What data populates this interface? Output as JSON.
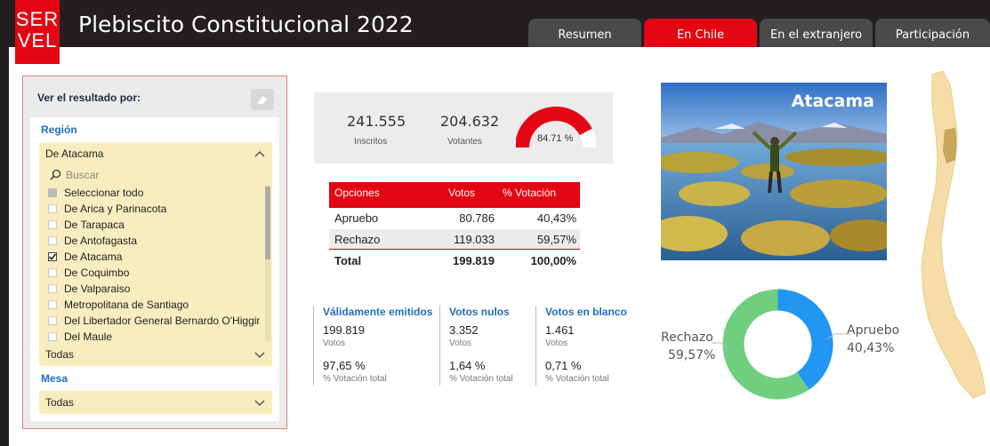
{
  "header": {
    "logo_top": "SER",
    "logo_bottom": "VEL",
    "title": "Plebiscito Constitucional 2022",
    "colors": {
      "brand": "#e30613",
      "header_bg": "#231f20"
    }
  },
  "tabs": [
    {
      "label": "Resumen",
      "active": false
    },
    {
      "label": "En Chile",
      "active": true
    },
    {
      "label": "En el extranjero",
      "active": false
    },
    {
      "label": "Participación",
      "active": false
    }
  ],
  "filter": {
    "title": "Ver el resultado por:",
    "eraser_icon": "eraser-icon",
    "region_label": "Región",
    "region_selected": "De Atacama",
    "search_placeholder": "Buscar",
    "items": [
      {
        "label": "Seleccionar todo",
        "state": "partial"
      },
      {
        "label": "De Arica y Parinacota",
        "state": "unchecked"
      },
      {
        "label": "De Tarapaca",
        "state": "unchecked"
      },
      {
        "label": "De Antofagasta",
        "state": "unchecked"
      },
      {
        "label": "De Atacama",
        "state": "checked"
      },
      {
        "label": "De Coquimbo",
        "state": "unchecked"
      },
      {
        "label": "De Valparaiso",
        "state": "unchecked"
      },
      {
        "label": "Metropolitana de Santiago",
        "state": "unchecked"
      },
      {
        "label": "Del Libertador General Bernardo O'Higgins",
        "state": "unchecked"
      },
      {
        "label": "Del Maule",
        "state": "unchecked"
      }
    ],
    "comuna_value": "Todas",
    "mesa_label": "Mesa",
    "mesa_value": "Todas"
  },
  "stats": {
    "inscritos_value": "241.555",
    "inscritos_label": "Inscritos",
    "votantes_value": "204.632",
    "votantes_label": "Votantes",
    "participation_pct": "84.71 %",
    "participation_fraction": 0.8471
  },
  "results_table": {
    "headers": [
      "Opciones",
      "Votos",
      "% Votación"
    ],
    "rows": [
      {
        "option": "Apruebo",
        "votes": "80.786",
        "pct": "40,43%"
      },
      {
        "option": "Rechazo",
        "votes": "119.033",
        "pct": "59,57%"
      }
    ],
    "total": {
      "option": "Total",
      "votes": "199.819",
      "pct": "100,00%"
    }
  },
  "vote_breakdown": [
    {
      "title": "Válidamente emitidos",
      "count": "199.819",
      "count_label": "Votos",
      "pct": "97,65 %",
      "pct_label": "% Votación total"
    },
    {
      "title": "Votos nulos",
      "count": "3.352",
      "count_label": "Votos",
      "pct": "1,64 %",
      "pct_label": "% Votación total"
    },
    {
      "title": "Votos en blanco",
      "count": "1.461",
      "count_label": "Votos",
      "pct": "0,71 %",
      "pct_label": "% Votación total"
    }
  ],
  "photo": {
    "label": "Atacama"
  },
  "donut": {
    "rechazo_label": "Rechazo",
    "rechazo_pct": "59,57%",
    "apruebo_label": "Apruebo",
    "apruebo_pct": "40,43%",
    "rechazo_fraction": 0.5957,
    "apruebo_fraction": 0.4043,
    "colors": {
      "rechazo": "#6fcf7f",
      "apruebo": "#2196f3"
    }
  }
}
